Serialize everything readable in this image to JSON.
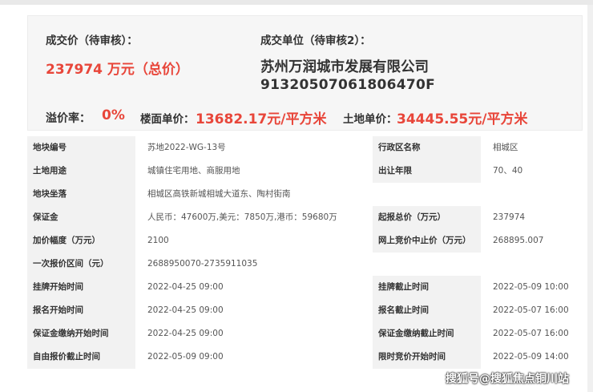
{
  "summary": {
    "price_label": "成交价（待审核）：",
    "price_value": "237974 万元（总价）",
    "unit_label": "成交单位（待审核2）：",
    "company_name": "苏州万润城市发展有限公司",
    "company_code": "91320507061806470F",
    "premium_label": "溢价率：",
    "premium_value": "0%",
    "floor_price_label": "楼面单价：",
    "floor_price_value": "13682.17元/平方米",
    "land_price_label": "土地单价：",
    "land_price_value": "34445.55元/平方米"
  },
  "rows": [
    {
      "k1": "地块编号",
      "v1": "苏地2022-WG-13号",
      "k2": "行政区名称",
      "v2": "相城区"
    },
    {
      "k1": "土地用途",
      "v1": "城镇住宅用地、商服用地",
      "k2": "出让年限",
      "v2": "70、40"
    },
    {
      "k1": "地块坐落",
      "v1": "相城区高铁新城相城大道东、陶村街南"
    },
    {
      "k1": "保证金",
      "v1": "人民币：47600万,美元：7850万,港币：59680万",
      "k2": "起报总价（万元）",
      "v2": "237974"
    },
    {
      "k1": "加价幅度（万元）",
      "v1": "2100",
      "k2": "网上竞价中止价（万元）",
      "v2": "268895.007"
    },
    {
      "k1": "一次报价区间（元）",
      "v1": "2688950070-2735911035"
    },
    {
      "k1": "挂牌开始时间",
      "v1": "2022-04-25 09:00",
      "k2": "挂牌截止时间",
      "v2": "2022-05-09 10:00"
    },
    {
      "k1": "报名开始时间",
      "v1": "2022-04-25 09:00",
      "k2": "报名截止时间",
      "v2": "2022-05-07 16:00"
    },
    {
      "k1": "保证金缴纳开始时间",
      "v1": "2022-04-25 09:00",
      "k2": "保证金缴纳截止时间",
      "v2": "2022-05-07 16:00"
    },
    {
      "k1": "自由报价截止时间",
      "v1": "2022-05-09 09:00",
      "k2": "限时竞价开始时间",
      "v2": "2022-05-09 14:00"
    }
  ],
  "watermark": "搜狐号@搜狐焦点铜川站",
  "colors": {
    "accent_red": "#e8463a",
    "label_bg": "#f2f2f2",
    "summary_bg": "#f6f6f6"
  }
}
